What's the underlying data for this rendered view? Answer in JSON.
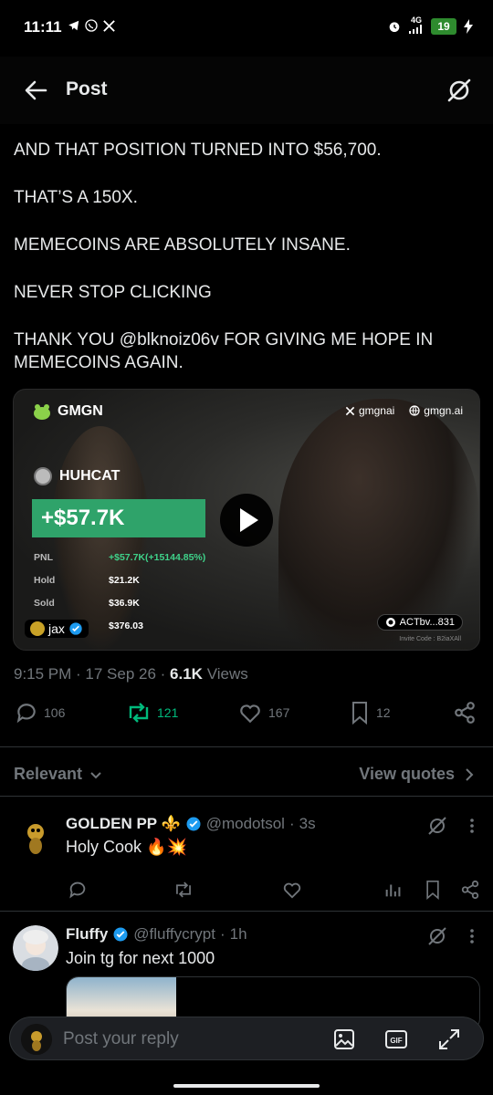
{
  "status_bar": {
    "time": "11:11",
    "network": "4G",
    "battery": "19",
    "icons": [
      "telegram-icon",
      "whatsapp-icon",
      "x-icon",
      "alarm-icon",
      "signal-icon",
      "charging-icon"
    ]
  },
  "header": {
    "title": "Post"
  },
  "tweet": {
    "paragraphs": [
      "AND THAT POSITION TURNED INTO $56,700.",
      "THAT’S A 150X.",
      "MEMECOINS ARE ABSOLUTELY INSANE.",
      "NEVER STOP CLICKING",
      "THANK YOU @blknoiz06v FOR GIVING ME HOPE IN MEMECOINS AGAIN."
    ],
    "time": "9:15 PM",
    "date": "17 Sep 26",
    "views_count": "6.1K",
    "views_label": "Views"
  },
  "media": {
    "brand": "GMGN",
    "links": [
      "gmgnai",
      "gmgn.ai"
    ],
    "token": "HUHCAT",
    "pnl_big": "+$57.7K",
    "stats": [
      {
        "label": "PNL",
        "value": "+$57.7K(+15144.85%)"
      },
      {
        "label": "Hold",
        "value": "$21.2K"
      },
      {
        "label": "Sold",
        "value": "$36.9K"
      },
      {
        "label": "",
        "value": "$376.03"
      }
    ],
    "user": "jax",
    "wallet": "ACTbv...831",
    "invite": "Invite Code : B2iaXAll"
  },
  "actions": {
    "replies": "106",
    "reposts": "121",
    "likes": "167",
    "bookmarks": "12"
  },
  "sort": {
    "label": "Relevant",
    "view_quotes": "View quotes"
  },
  "replies": [
    {
      "name": "GOLDEN PP ⚜️",
      "handle": "@modotsol",
      "time": "3s",
      "text": "Holy Cook 🔥💥"
    },
    {
      "name": "Fluffy",
      "handle": "@fluffycrypt",
      "time": "1h",
      "text": "Join tg for next 1000"
    }
  ],
  "reply_bar": {
    "placeholder": "Post your reply"
  },
  "colors": {
    "accent": "#1d9bf0",
    "repost_green": "#00ba7c",
    "muted": "#71767b",
    "pnl_green": "#2fa36a"
  }
}
